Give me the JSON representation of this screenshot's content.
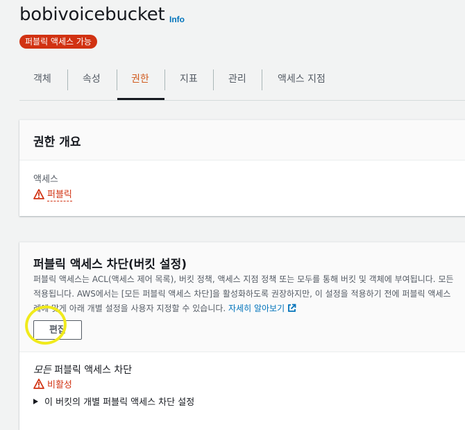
{
  "bucket": {
    "name": "bobivoicebucket",
    "info_label": "Info",
    "badge": "퍼블릭 액세스 가능"
  },
  "tabs": [
    {
      "label": "객체"
    },
    {
      "label": "속성"
    },
    {
      "label": "권한",
      "active": true
    },
    {
      "label": "지표"
    },
    {
      "label": "관리"
    },
    {
      "label": "액세스 지점"
    }
  ],
  "overview": {
    "title": "권한 개요",
    "access_label": "액세스",
    "access_value": "퍼블릭"
  },
  "block_public": {
    "title": "퍼블릭 액세스 차단(버킷 설정)",
    "desc_line1": "퍼블릭 액세스는 ACL(액세스 제어 목록), 버킷 정책, 액세스 지점 정책 또는 모두를 통해 버킷 및 객체에 부여됩니다. 모든",
    "desc_line2": "적용됩니다. AWS에서는 [모든 퍼블릭 액세스 차단]을 활성화하도록 권장하지만, 이 설정을 적용하기 전에 퍼블릭 액세스",
    "desc_line3": "례에 맞게 아래 개별 설정을 사용자 지정할 수 있습니다.",
    "learn_more": "자세히 알아보기",
    "edit_button": "편집",
    "block_all_prefix": "모든",
    "block_all_suffix": " 퍼블릭 액세스 차단",
    "block_all_status": "비활성",
    "individual_settings": "이 버킷의 개별 퍼블릭 액세스 차단 설정"
  },
  "colors": {
    "accent_link": "#0073bb",
    "danger": "#d13212",
    "active_tab": "#d05a1e",
    "highlight": "#f0ea1c"
  },
  "icons": [
    "warning-icon",
    "external-link-icon",
    "caret-right-icon"
  ]
}
